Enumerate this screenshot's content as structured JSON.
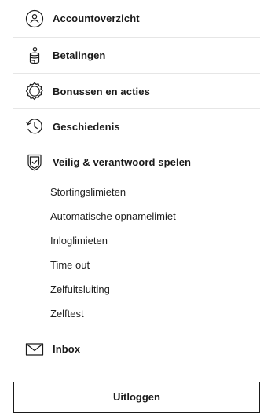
{
  "menu": {
    "items": [
      {
        "label": "Accountoverzicht",
        "icon": "user-circle-icon"
      },
      {
        "label": "Betalingen",
        "icon": "coins-icon"
      },
      {
        "label": "Bonussen en acties",
        "icon": "bonus-gear-icon"
      },
      {
        "label": "Geschiedenis",
        "icon": "history-icon"
      }
    ],
    "safe_play": {
      "label": "Veilig & verantwoord spelen",
      "icon": "shield-icon",
      "subitems": [
        "Stortingslimieten",
        "Automatische opnamelimiet",
        "Inloglimieten",
        "Time out",
        "Zelfuitsluiting",
        "Zelftest"
      ]
    },
    "inbox": {
      "label": "Inbox",
      "icon": "envelope-icon"
    }
  },
  "logout": {
    "label": "Uitloggen"
  }
}
